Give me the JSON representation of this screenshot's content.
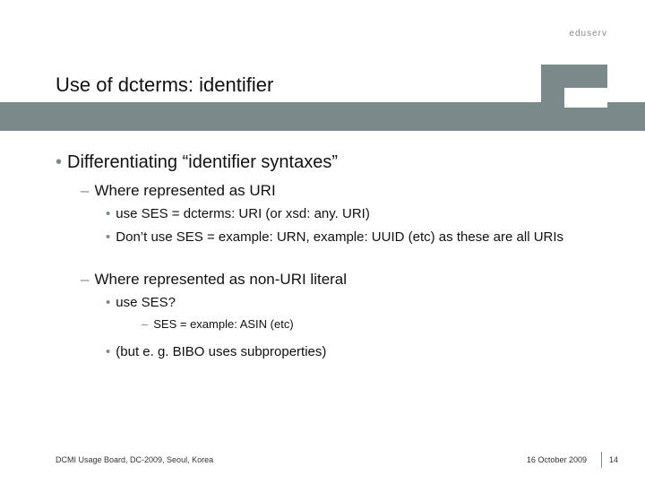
{
  "brand": "eduserv",
  "title": "Use of dcterms: identifier",
  "bullets": {
    "l1": "Differentiating “identifier syntaxes”",
    "l2a": "Where represented as URI",
    "l3a1": "use SES = dcterms: URI (or xsd: any. URI)",
    "l3a2": "Don’t use SES = example: URN, example: UUID (etc) as these are all URIs",
    "l2b": "Where represented as non-URI literal",
    "l3b1": "use SES?",
    "l4b1": "SES = example: ASIN (etc)",
    "l3b2": "(but e. g. BIBO uses subproperties)"
  },
  "footer": {
    "left": "DCMI Usage Board, DC-2009, Seoul, Korea",
    "date": "16 October 2009",
    "page": "14"
  }
}
